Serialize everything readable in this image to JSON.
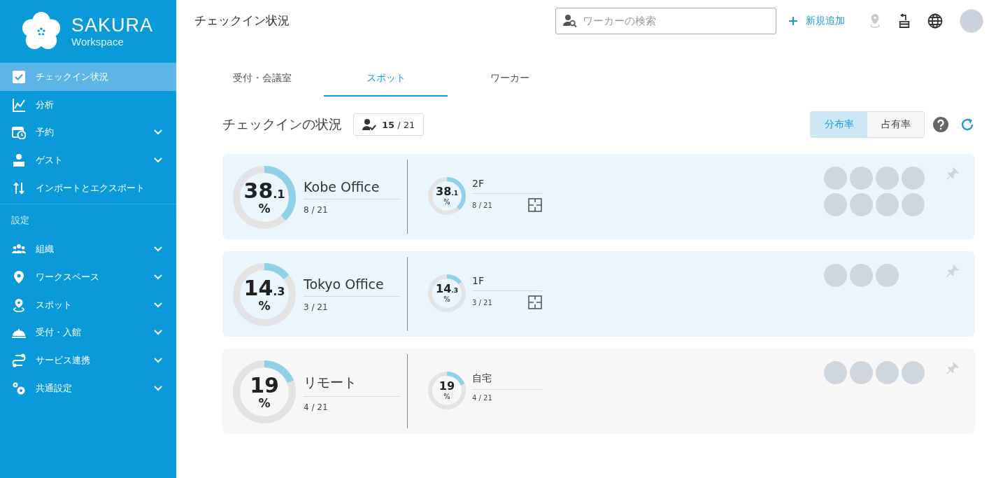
{
  "brand": {
    "name": "SAKURA",
    "subtitle": "Workspace"
  },
  "nav": [
    {
      "label": "チェックイン状況",
      "expandable": false,
      "selected": true
    },
    {
      "label": "分析",
      "expandable": false,
      "selected": false
    },
    {
      "label": "予約",
      "expandable": true,
      "selected": false
    },
    {
      "label": "ゲスト",
      "expandable": true,
      "selected": false
    },
    {
      "label": "インポートとエクスポート",
      "expandable": false,
      "selected": false
    }
  ],
  "settings_heading": "設定",
  "settings_nav": [
    {
      "label": "組織",
      "expandable": true,
      "selected": false
    },
    {
      "label": "ワークスペース",
      "expandable": true,
      "selected": false
    },
    {
      "label": "スポット",
      "expandable": true,
      "selected": false
    },
    {
      "label": "受付・入館",
      "expandable": true,
      "selected": false
    },
    {
      "label": "サービス連携",
      "expandable": true,
      "selected": false
    },
    {
      "label": "共通設定",
      "expandable": true,
      "selected": false
    }
  ],
  "page_title": "チェックイン状況",
  "search": {
    "placeholder": "ワーカーの検索"
  },
  "add_button": "新規追加",
  "tabs": [
    {
      "label": "受付・会議室",
      "selected": false
    },
    {
      "label": "スポット",
      "selected": true
    },
    {
      "label": "ワーカー",
      "selected": false
    }
  ],
  "section_title": "チェックインの状況",
  "checkin_count": "**15** / 21",
  "view_toggle": [
    {
      "label": "分布率",
      "selected": true
    },
    {
      "label": "占有率",
      "selected": false
    }
  ],
  "locations": [
    {
      "kind": "office",
      "name": "Kobe Office",
      "value": "38",
      "decimal": ".1",
      "unit": "%",
      "count": "8 / 21",
      "level": 0.381,
      "zones": [
        {
          "name": "2F",
          "value": "38",
          "decimal": ".1",
          "unit": "%",
          "count": "8 / 21",
          "level": 0.381,
          "floorplan": true
        }
      ],
      "avatars": [
        {
          "kind": "photo"
        },
        {
          "kind": "photo"
        },
        {
          "kind": "photo"
        },
        {
          "kind": "photo"
        },
        {
          "kind": "photo"
        },
        {
          "kind": "photo"
        },
        {
          "kind": "photo"
        },
        {
          "kind": "photo"
        }
      ]
    },
    {
      "kind": "office",
      "name": "Tokyo Office",
      "value": "14",
      "decimal": ".3",
      "unit": "%",
      "count": "3 / 21",
      "level": 0.143,
      "zones": [
        {
          "name": "1F",
          "value": "14",
          "decimal": ".3",
          "unit": "%",
          "count": "3 / 21",
          "level": 0.143,
          "floorplan": true
        }
      ],
      "avatars": [
        {
          "kind": "photo"
        },
        {
          "kind": "photo"
        },
        {
          "kind": "photo"
        }
      ]
    },
    {
      "kind": "remote",
      "name": "リモート",
      "value": "19",
      "unit": "%",
      "count": "4 / 21",
      "level": 0.19,
      "zones": [
        {
          "name": "自宅",
          "value": "19",
          "unit": "%",
          "count": "4 / 21",
          "level": 0.19,
          "floorplan": false
        }
      ],
      "avatars": [
        {
          "kind": "photo"
        },
        {
          "kind": "photo"
        },
        {
          "kind": "photo"
        },
        {
          "kind": "photo"
        }
      ]
    }
  ]
}
